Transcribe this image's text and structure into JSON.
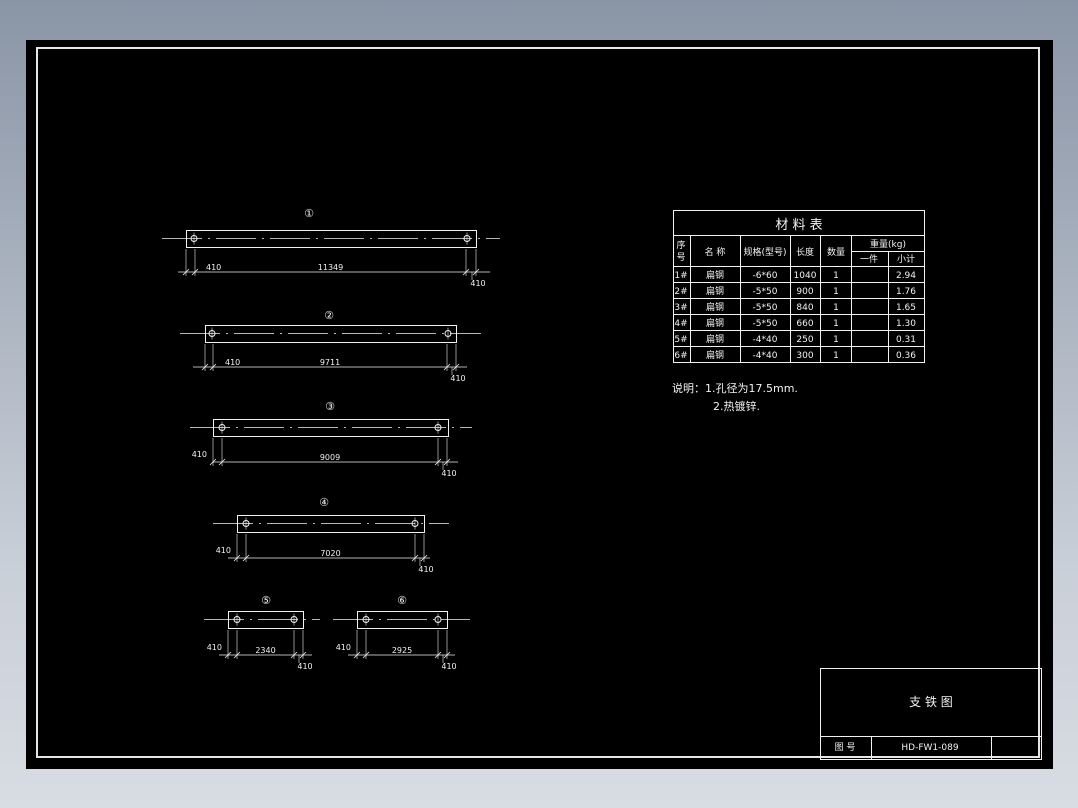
{
  "drawing": {
    "parts": [
      {
        "mark": "①",
        "left_offset": "410",
        "length": "11349",
        "right_offset": "410"
      },
      {
        "mark": "②",
        "left_offset": "410",
        "length": "9711",
        "right_offset": "410"
      },
      {
        "mark": "③",
        "left_offset": "410",
        "length": "9009",
        "right_offset": "410"
      },
      {
        "mark": "④",
        "left_offset": "410",
        "length": "7020",
        "right_offset": "410"
      },
      {
        "mark": "⑤",
        "left_offset": "410",
        "length": "2340",
        "right_offset": "410"
      },
      {
        "mark": "⑥",
        "left_offset": "410",
        "length": "2925",
        "right_offset": "410"
      }
    ]
  },
  "materials": {
    "title": "材    料    表",
    "headers": {
      "seq": "序",
      "seq2": "号",
      "name": "名  称",
      "spec": "规格(型号)",
      "length": "长度",
      "qty": "数量",
      "weight": "重量(kg)",
      "piece": "一件",
      "subtotal": "小计"
    },
    "rows": [
      {
        "seq": "1#",
        "name": "扁钢",
        "spec": "-6*60",
        "length": "1040",
        "qty": "1",
        "piece": "",
        "subtotal": "2.94"
      },
      {
        "seq": "2#",
        "name": "扁钢",
        "spec": "-5*50",
        "length": "900",
        "qty": "1",
        "piece": "",
        "subtotal": "1.76"
      },
      {
        "seq": "3#",
        "name": "扁钢",
        "spec": "-5*50",
        "length": "840",
        "qty": "1",
        "piece": "",
        "subtotal": "1.65"
      },
      {
        "seq": "4#",
        "name": "扁钢",
        "spec": "-5*50",
        "length": "660",
        "qty": "1",
        "piece": "",
        "subtotal": "1.30"
      },
      {
        "seq": "5#",
        "name": "扁钢",
        "spec": "-4*40",
        "length": "250",
        "qty": "1",
        "piece": "",
        "subtotal": "0.31"
      },
      {
        "seq": "6#",
        "name": "扁钢",
        "spec": "-4*40",
        "length": "300",
        "qty": "1",
        "piece": "",
        "subtotal": "0.36"
      }
    ]
  },
  "notes": {
    "line1": "说明：1.孔径为17.5mm.",
    "line2": "2.热镀锌."
  },
  "title_block": {
    "title": "支  铁  图",
    "drawing_no_label": "图  号",
    "drawing_no": "HD-FW1-089"
  },
  "colors": {
    "background": "#000000",
    "lines": "#f2f2f2",
    "outer": "#8a95a6"
  }
}
